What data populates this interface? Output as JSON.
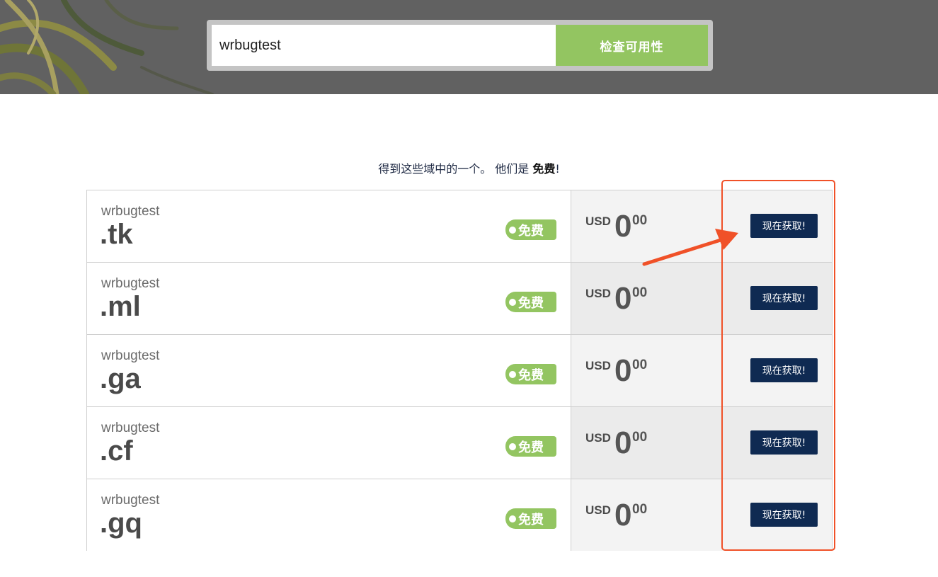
{
  "search": {
    "value": "wrbugtest",
    "button_label": "检查可用性"
  },
  "subtitle": {
    "text": "得到这些域中的一个。 他们是 ",
    "emphasis": "免费",
    "suffix": "!"
  },
  "domains": [
    {
      "label": "wrbugtest",
      "tld": ".tk",
      "badge": "免费",
      "currency": "USD",
      "amount": "0",
      "cents": "00",
      "button": "现在获取!"
    },
    {
      "label": "wrbugtest",
      "tld": ".ml",
      "badge": "免费",
      "currency": "USD",
      "amount": "0",
      "cents": "00",
      "button": "现在获取!"
    },
    {
      "label": "wrbugtest",
      "tld": ".ga",
      "badge": "免费",
      "currency": "USD",
      "amount": "0",
      "cents": "00",
      "button": "现在获取!"
    },
    {
      "label": "wrbugtest",
      "tld": ".cf",
      "badge": "免费",
      "currency": "USD",
      "amount": "0",
      "cents": "00",
      "button": "现在获取!"
    },
    {
      "label": "wrbugtest",
      "tld": ".gq",
      "badge": "免费",
      "currency": "USD",
      "amount": "0",
      "cents": "00",
      "button": "现在获取!"
    }
  ],
  "colors": {
    "accent_green": "#93c561",
    "button_navy": "#0f2a52",
    "annotation_red": "#f05128",
    "hero_gray": "#616161"
  }
}
